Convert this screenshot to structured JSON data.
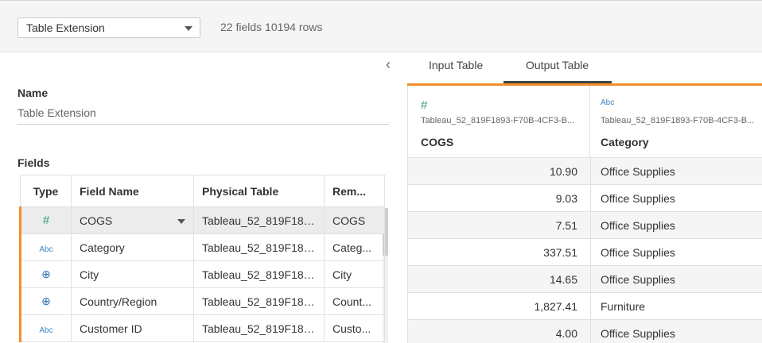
{
  "topbar": {
    "table_select": "Table Extension",
    "stats": "22 fields 10194 rows"
  },
  "left": {
    "collapse_glyph": "‹",
    "name_label": "Name",
    "name_value": "Table Extension",
    "fields_label": "Fields",
    "columns": [
      "Type",
      "Field Name",
      "Physical Table",
      "Rem..."
    ],
    "rows": [
      {
        "type_icon": "#",
        "type_name": "number-icon",
        "field": "COGS",
        "physical": "Tableau_52_819F189...",
        "remote": "COGS"
      },
      {
        "type_icon": "Abc",
        "type_name": "string-icon",
        "field": "Category",
        "physical": "Tableau_52_819F189...",
        "remote": "Categ..."
      },
      {
        "type_icon": "⊕",
        "type_name": "globe-icon",
        "field": "City",
        "physical": "Tableau_52_819F189...",
        "remote": "City"
      },
      {
        "type_icon": "⊕",
        "type_name": "globe-icon",
        "field": "Country/Region",
        "physical": "Tableau_52_819F189...",
        "remote": "Count..."
      },
      {
        "type_icon": "Abc",
        "type_name": "string-icon",
        "field": "Customer ID",
        "physical": "Tableau_52_819F189...",
        "remote": "Custo..."
      }
    ]
  },
  "right": {
    "tabs": [
      "Input Table",
      "Output Table"
    ],
    "active_tab": "Output Table",
    "accent_color": "#f28e2b",
    "columns": [
      {
        "icon": "#",
        "source": "Tableau_52_819F1893-F70B-4CF3-B...",
        "name": "COGS"
      },
      {
        "icon": "Abc",
        "source": "Tableau_52_819F1893-F70B-4CF3-B...",
        "name": "Category"
      }
    ],
    "rows": [
      [
        "10.90",
        "Office Supplies"
      ],
      [
        "9.03",
        "Office Supplies"
      ],
      [
        "7.51",
        "Office Supplies"
      ],
      [
        "337.51",
        "Office Supplies"
      ],
      [
        "14.65",
        "Office Supplies"
      ],
      [
        "1,827.41",
        "Furniture"
      ],
      [
        "4.00",
        "Office Supplies"
      ]
    ]
  }
}
